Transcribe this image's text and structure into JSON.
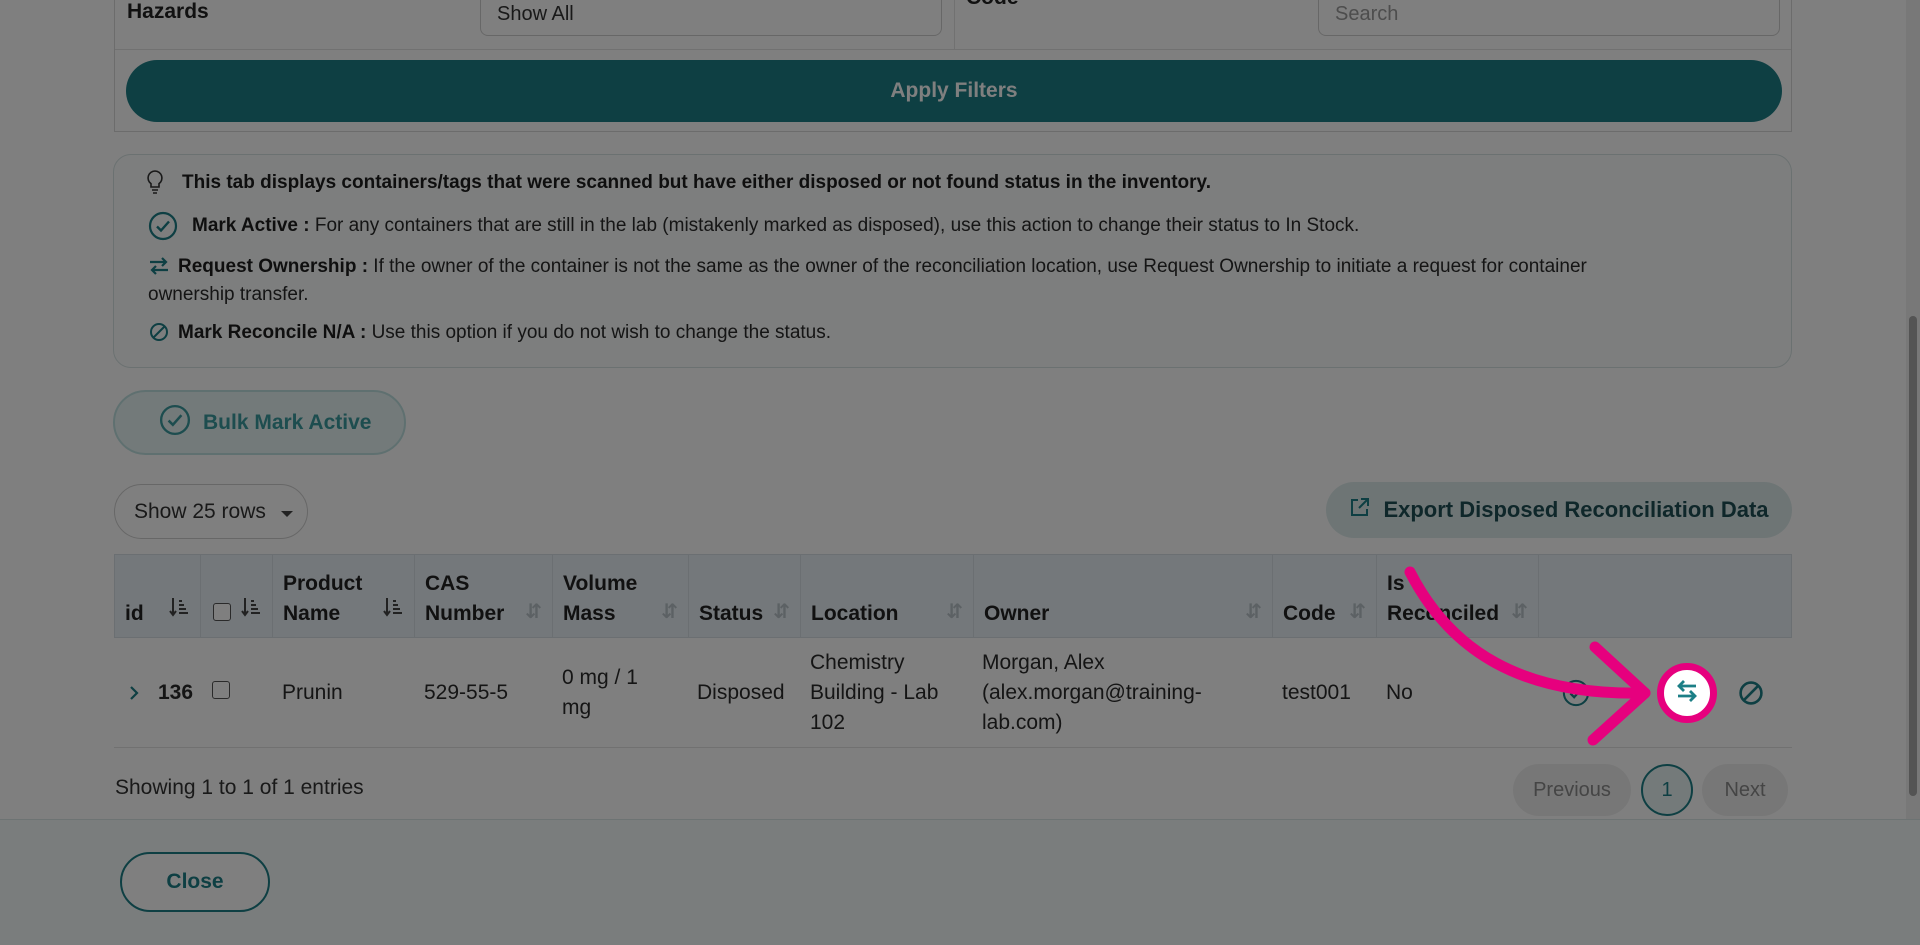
{
  "filters": {
    "hazards_label": "Hazards",
    "hazards_value": "Show All",
    "code_label": "Code",
    "code_placeholder": "Search",
    "apply_label": "Apply Filters"
  },
  "info": {
    "headline": "This tab displays containers/tags that were scanned but have either disposed or not found status in the inventory.",
    "mark_active_title": "Mark Active :",
    "mark_active_text": " For any containers that are still in the lab (mistakenly marked as disposed), use this action to change their status to In Stock.",
    "request_title": "Request Ownership :",
    "request_text": " If the owner of the container is not the same as the owner of the reconciliation location, use Request Ownership to initiate a request for container",
    "request_text2": "ownership transfer.",
    "na_title": "Mark Reconcile N/A :",
    "na_text": " Use this option if you do not wish to change the status."
  },
  "bulk_label": "Bulk Mark Active",
  "rows_label": "Show 25 rows",
  "export_label": "Export Disposed Reconciliation Data",
  "table": {
    "headers": {
      "id": "id",
      "product_1": "Product",
      "product_2": "Name",
      "cas_1": "CAS",
      "cas_2": "Number",
      "vol_1": "Volume",
      "vol_2": "Mass",
      "status": "Status",
      "location": "Location",
      "owner": "Owner",
      "code": "Code",
      "rec_1": "Is",
      "rec_2": "Reconciled"
    },
    "row": {
      "id": "136",
      "product": "Prunin",
      "cas": "529-55-5",
      "vol_1": "0 mg / 1",
      "vol_2": "mg",
      "status": "Disposed",
      "loc_1": "Chemistry",
      "loc_2": "Building - Lab",
      "loc_3": "102",
      "owner_1": "Morgan, Alex",
      "owner_2": "(alex.morgan@training-",
      "owner_3": "lab.com)",
      "code": "test001",
      "reconciled": "No"
    }
  },
  "pagination": {
    "showing": "Showing 1 to 1 of 1 entries",
    "previous": "Previous",
    "page": "1",
    "next": "Next"
  },
  "close_label": "Close",
  "colors": {
    "teal": "#1c7f86",
    "highlight": "#e6007e"
  }
}
